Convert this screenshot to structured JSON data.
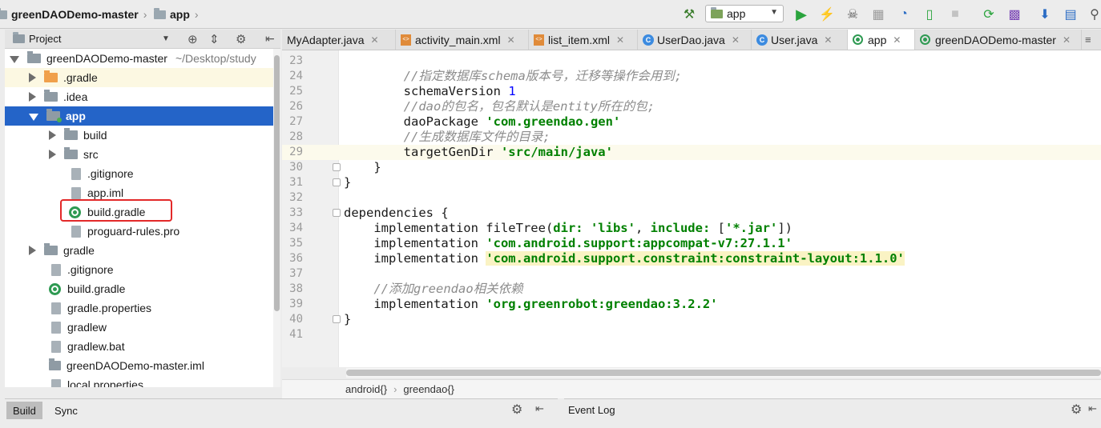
{
  "navbar": {
    "project_crumb": "greenDAODemo-master",
    "module_crumb": "app",
    "run_config": "app",
    "icons": [
      "hammer-icon",
      "run-icon",
      "apply-changes-icon",
      "debug-icon",
      "coverage-icon",
      "profiler-icon",
      "attach-debugger-icon",
      "stop-icon",
      "sync-gradle-icon",
      "avd-manager-icon",
      "sdk-manager-icon",
      "project-structure-icon"
    ]
  },
  "project_panel": {
    "title": "Project",
    "tree": [
      {
        "label": "greenDAODemo-master",
        "extra": "~/Desktop/study",
        "indent": 0,
        "icon": "module-folder",
        "state": "expanded"
      },
      {
        "label": ".gradle",
        "indent": 1,
        "icon": "folder-orange",
        "state": "collapsed"
      },
      {
        "label": ".idea",
        "indent": 1,
        "icon": "folder",
        "state": "collapsed"
      },
      {
        "label": "app",
        "indent": 1,
        "icon": "module-folder",
        "state": "expanded"
      },
      {
        "label": "build",
        "indent": 2,
        "icon": "folder",
        "state": "collapsed"
      },
      {
        "label": "src",
        "indent": 2,
        "icon": "folder",
        "state": "collapsed"
      },
      {
        "label": ".gitignore",
        "indent": 2,
        "icon": "file"
      },
      {
        "label": "app.iml",
        "indent": 2,
        "icon": "file"
      },
      {
        "label": "build.gradle",
        "indent": 2,
        "icon": "gradle"
      },
      {
        "label": "proguard-rules.pro",
        "indent": 2,
        "icon": "file"
      },
      {
        "label": "gradle",
        "indent": 1,
        "icon": "folder",
        "state": "collapsed"
      },
      {
        "label": ".gitignore",
        "indent": 1,
        "icon": "file"
      },
      {
        "label": "build.gradle",
        "indent": 1,
        "icon": "gradle"
      },
      {
        "label": "gradle.properties",
        "indent": 1,
        "icon": "file"
      },
      {
        "label": "gradlew",
        "indent": 1,
        "icon": "file"
      },
      {
        "label": "gradlew.bat",
        "indent": 1,
        "icon": "file"
      },
      {
        "label": "greenDAODemo-master.iml",
        "indent": 1,
        "icon": "file"
      },
      {
        "label": "local.properties",
        "indent": 1,
        "icon": "file"
      }
    ]
  },
  "editor_tabs": [
    {
      "label": "MyAdapter.java",
      "icon": "class-icon"
    },
    {
      "label": "activity_main.xml",
      "icon": "xml-icon"
    },
    {
      "label": "list_item.xml",
      "icon": "xml-icon"
    },
    {
      "label": "UserDao.java",
      "icon": "class-icon"
    },
    {
      "label": "User.java",
      "icon": "class-icon"
    },
    {
      "label": "app",
      "icon": "gradle-icon",
      "active": true
    },
    {
      "label": "greenDAODemo-master",
      "icon": "gradle-icon"
    }
  ],
  "editor": {
    "lines": [
      {
        "n": "23",
        "parts": []
      },
      {
        "n": "24",
        "parts": [
          {
            "t": "        "
          },
          {
            "t": "//指定数据库schema版本号，迁移等操作会用到;",
            "c": "cm"
          }
        ]
      },
      {
        "n": "25",
        "parts": [
          {
            "t": "        schemaVersion "
          },
          {
            "t": "1",
            "c": "num"
          }
        ]
      },
      {
        "n": "26",
        "parts": [
          {
            "t": "        "
          },
          {
            "t": "//dao的包名，包名默认是entity所在的包;",
            "c": "cm"
          }
        ]
      },
      {
        "n": "27",
        "parts": [
          {
            "t": "        daoPackage "
          },
          {
            "t": "'com.greendao.gen'",
            "c": "str"
          }
        ]
      },
      {
        "n": "28",
        "parts": [
          {
            "t": "        "
          },
          {
            "t": "//生成数据库文件的目录;",
            "c": "cm"
          }
        ]
      },
      {
        "n": "29",
        "parts": [
          {
            "t": "        targetGenDir "
          },
          {
            "t": "'src/main/java'",
            "c": "str"
          }
        ],
        "current": true
      },
      {
        "n": "30",
        "parts": [
          {
            "t": "    }"
          }
        ]
      },
      {
        "n": "31",
        "parts": [
          {
            "t": "}"
          }
        ]
      },
      {
        "n": "32",
        "parts": []
      },
      {
        "n": "33",
        "parts": [
          {
            "t": "dependencies {"
          }
        ]
      },
      {
        "n": "34",
        "parts": [
          {
            "t": "    implementation fileTree("
          },
          {
            "t": "dir: ",
            "c": "str"
          },
          {
            "t": "'libs'",
            "c": "str"
          },
          {
            "t": ", "
          },
          {
            "t": "include: ",
            "c": "str"
          },
          {
            "t": "["
          },
          {
            "t": "'*.jar'",
            "c": "str"
          },
          {
            "t": "])"
          }
        ]
      },
      {
        "n": "35",
        "parts": [
          {
            "t": "    implementation "
          },
          {
            "t": "'com.android.support:appcompat-v7:27.1.1'",
            "c": "str"
          }
        ]
      },
      {
        "n": "36",
        "parts": [
          {
            "t": "    implementation "
          },
          {
            "t": "'com.android.support.constraint:constraint-layout:1.1.0'",
            "c": "strhl"
          }
        ]
      },
      {
        "n": "37",
        "parts": []
      },
      {
        "n": "38",
        "parts": [
          {
            "t": "    "
          },
          {
            "t": "//添加greendao相关依赖",
            "c": "cm"
          }
        ]
      },
      {
        "n": "39",
        "parts": [
          {
            "t": "    implementation "
          },
          {
            "t": "'org.greenrobot:greendao:3.2.2'",
            "c": "str"
          }
        ]
      },
      {
        "n": "40",
        "parts": [
          {
            "t": "}"
          }
        ]
      },
      {
        "n": "41",
        "parts": []
      }
    ]
  },
  "breadcrumb": {
    "item1": "android{}",
    "item2": "greendao{}"
  },
  "bottom": {
    "build_tab": "Build",
    "sync_tab": "Sync",
    "event_log_title": "Event Log"
  }
}
